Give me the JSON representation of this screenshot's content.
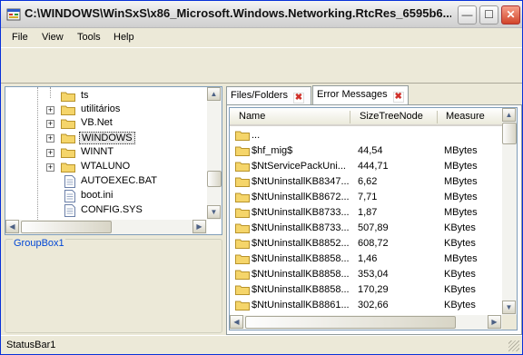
{
  "window": {
    "title": "C:\\WINDOWS\\WinSxS\\x86_Microsoft.Windows.Networking.RtcRes_6595b6...",
    "minimize_glyph": "—",
    "maximize_glyph": "☐",
    "close_glyph": "✕"
  },
  "menu": [
    "File",
    "View",
    "Tools",
    "Help"
  ],
  "tree": {
    "items": [
      {
        "label": "ts",
        "type": "folder",
        "expander": ""
      },
      {
        "label": "utilitários",
        "type": "folder",
        "expander": "+"
      },
      {
        "label": "VB.Net",
        "type": "folder",
        "expander": "+"
      },
      {
        "label": "WINDOWS",
        "type": "folder",
        "expander": "+",
        "selected": true
      },
      {
        "label": "WINNT",
        "type": "folder",
        "expander": "+"
      },
      {
        "label": "WTALUNO",
        "type": "folder",
        "expander": "+"
      },
      {
        "label": "AUTOEXEC.BAT",
        "type": "file",
        "expander": ""
      },
      {
        "label": "boot.ini",
        "type": "file",
        "expander": ""
      },
      {
        "label": "CONFIG.SYS",
        "type": "file",
        "expander": ""
      }
    ]
  },
  "groupbox": {
    "title": "GroupBox1"
  },
  "tabs": [
    {
      "label": "Files/Folders",
      "close_glyph": "✖"
    },
    {
      "label": "Error Messages",
      "close_glyph": "✖"
    }
  ],
  "listview": {
    "columns": [
      "Name",
      "SizeTreeNode",
      "Measure"
    ],
    "rows": [
      {
        "name": "...",
        "size": "",
        "measure": ""
      },
      {
        "name": "$hf_mig$",
        "size": "44,54",
        "measure": "MBytes"
      },
      {
        "name": "$NtServicePackUni...",
        "size": "444,71",
        "measure": "MBytes"
      },
      {
        "name": "$NtUninstallKB8347...",
        "size": "6,62",
        "measure": "MBytes"
      },
      {
        "name": "$NtUninstallKB8672...",
        "size": "7,71",
        "measure": "MBytes"
      },
      {
        "name": "$NtUninstallKB8733...",
        "size": "1,87",
        "measure": "MBytes"
      },
      {
        "name": "$NtUninstallKB8733...",
        "size": "507,89",
        "measure": "KBytes"
      },
      {
        "name": "$NtUninstallKB8852...",
        "size": "608,72",
        "measure": "KBytes"
      },
      {
        "name": "$NtUninstallKB8858...",
        "size": "1,46",
        "measure": "MBytes"
      },
      {
        "name": "$NtUninstallKB8858...",
        "size": "353,04",
        "measure": "KBytes"
      },
      {
        "name": "$NtUninstallKB8858...",
        "size": "170,29",
        "measure": "KBytes"
      },
      {
        "name": "$NtUninstallKB8861...",
        "size": "302,66",
        "measure": "KBytes"
      }
    ]
  },
  "statusbar": {
    "text": "StatusBar1"
  },
  "colors": {
    "folder": "#f5d56a",
    "accent": "#0046d5",
    "close": "#d0302a"
  }
}
